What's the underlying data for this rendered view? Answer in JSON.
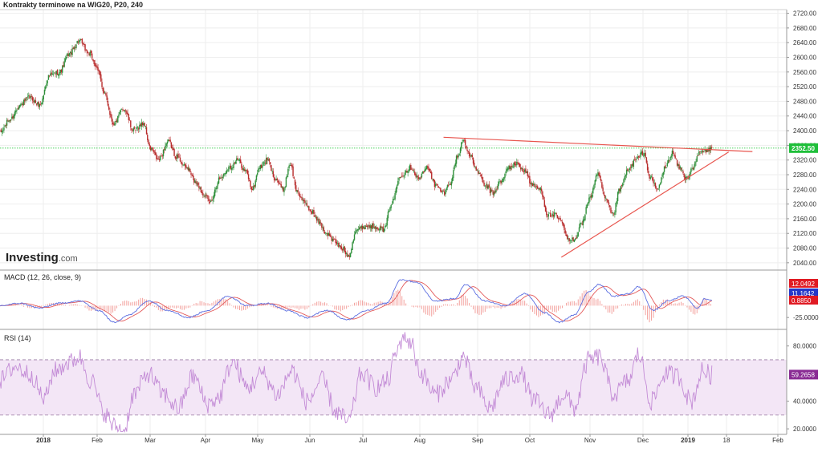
{
  "title": "Kontrakty terminowe na WIG20, P20, 240",
  "brand": {
    "name": "Investing",
    "suffix": ".com"
  },
  "colors": {
    "up": "#2f8f3a",
    "down": "#b82c2c",
    "grid": "#eeeeee",
    "border": "#c8c8c8",
    "text": "#333333",
    "price_line": "#27c93f",
    "trend": "#e8554e",
    "macd": "#5b6ee1",
    "signal": "#e35a5a",
    "hist_pos": "#f3a19d",
    "hist_neg": "#f3a19d",
    "rsi": "#c38bd6",
    "rsi_band": "#f3e6f6",
    "macd_tag": "#e01b24",
    "signal_tag": "#2438c9",
    "hist_tag": "#e01b24",
    "rsi_tag": "#8a2c94"
  },
  "x_axis": {
    "labels": [
      "2018",
      "Feb",
      "Mar",
      "Apr",
      "May",
      "Jun",
      "Jul",
      "Aug",
      "Sep",
      "Oct",
      "Nov",
      "Dec",
      "2019",
      "18",
      "Feb"
    ],
    "bold": [
      "2018",
      "2019"
    ]
  },
  "chart_data": [
    {
      "type": "candlestick",
      "name": "Kontrakty terminowe na WIG20, P20, 240",
      "y_ticks": [
        "2720.00",
        "2680.00",
        "2640.00",
        "2600.00",
        "2560.00",
        "2520.00",
        "2480.00",
        "2440.00",
        "2400.00",
        "2360.00",
        "2320.00",
        "2280.00",
        "2240.00",
        "2200.00",
        "2160.00",
        "2120.00",
        "2080.00",
        "2040.00"
      ],
      "ylim": [
        2020,
        2730
      ],
      "last_price": {
        "value": 2352.5,
        "label": "2352.50"
      },
      "anchors": [
        {
          "i": 0,
          "v": 2395
        },
        {
          "i": 10,
          "v": 2430
        },
        {
          "i": 20,
          "v": 2470
        },
        {
          "i": 30,
          "v": 2490
        },
        {
          "i": 40,
          "v": 2470
        },
        {
          "i": 50,
          "v": 2550
        },
        {
          "i": 60,
          "v": 2560
        },
        {
          "i": 70,
          "v": 2610
        },
        {
          "i": 80,
          "v": 2645
        },
        {
          "i": 90,
          "v": 2610
        },
        {
          "i": 100,
          "v": 2560
        },
        {
          "i": 105,
          "v": 2500
        },
        {
          "i": 115,
          "v": 2420
        },
        {
          "i": 125,
          "v": 2460
        },
        {
          "i": 135,
          "v": 2400
        },
        {
          "i": 145,
          "v": 2420
        },
        {
          "i": 152,
          "v": 2350
        },
        {
          "i": 160,
          "v": 2320
        },
        {
          "i": 170,
          "v": 2370
        },
        {
          "i": 178,
          "v": 2330
        },
        {
          "i": 188,
          "v": 2300
        },
        {
          "i": 198,
          "v": 2260
        },
        {
          "i": 205,
          "v": 2230
        },
        {
          "i": 212,
          "v": 2205
        },
        {
          "i": 222,
          "v": 2270
        },
        {
          "i": 232,
          "v": 2300
        },
        {
          "i": 240,
          "v": 2320
        },
        {
          "i": 248,
          "v": 2290
        },
        {
          "i": 255,
          "v": 2240
        },
        {
          "i": 262,
          "v": 2300
        },
        {
          "i": 270,
          "v": 2320
        },
        {
          "i": 278,
          "v": 2270
        },
        {
          "i": 286,
          "v": 2240
        },
        {
          "i": 293,
          "v": 2310
        },
        {
          "i": 300,
          "v": 2235
        },
        {
          "i": 308,
          "v": 2200
        },
        {
          "i": 315,
          "v": 2180
        },
        {
          "i": 322,
          "v": 2150
        },
        {
          "i": 330,
          "v": 2120
        },
        {
          "i": 337,
          "v": 2100
        },
        {
          "i": 345,
          "v": 2080
        },
        {
          "i": 352,
          "v": 2060
        },
        {
          "i": 360,
          "v": 2130
        },
        {
          "i": 370,
          "v": 2140
        },
        {
          "i": 378,
          "v": 2140
        },
        {
          "i": 388,
          "v": 2130
        },
        {
          "i": 395,
          "v": 2200
        },
        {
          "i": 405,
          "v": 2280
        },
        {
          "i": 415,
          "v": 2300
        },
        {
          "i": 423,
          "v": 2270
        },
        {
          "i": 432,
          "v": 2300
        },
        {
          "i": 440,
          "v": 2250
        },
        {
          "i": 448,
          "v": 2230
        },
        {
          "i": 455,
          "v": 2260
        },
        {
          "i": 462,
          "v": 2330
        },
        {
          "i": 468,
          "v": 2375
        },
        {
          "i": 475,
          "v": 2330
        },
        {
          "i": 482,
          "v": 2290
        },
        {
          "i": 490,
          "v": 2250
        },
        {
          "i": 498,
          "v": 2230
        },
        {
          "i": 506,
          "v": 2260
        },
        {
          "i": 514,
          "v": 2300
        },
        {
          "i": 522,
          "v": 2310
        },
        {
          "i": 530,
          "v": 2290
        },
        {
          "i": 538,
          "v": 2250
        },
        {
          "i": 546,
          "v": 2240
        },
        {
          "i": 553,
          "v": 2170
        },
        {
          "i": 560,
          "v": 2170
        },
        {
          "i": 567,
          "v": 2150
        },
        {
          "i": 574,
          "v": 2100
        },
        {
          "i": 580,
          "v": 2105
        },
        {
          "i": 588,
          "v": 2150
        },
        {
          "i": 596,
          "v": 2220
        },
        {
          "i": 604,
          "v": 2280
        },
        {
          "i": 612,
          "v": 2210
        },
        {
          "i": 619,
          "v": 2170
        },
        {
          "i": 626,
          "v": 2240
        },
        {
          "i": 634,
          "v": 2290
        },
        {
          "i": 642,
          "v": 2320
        },
        {
          "i": 650,
          "v": 2340
        },
        {
          "i": 657,
          "v": 2270
        },
        {
          "i": 664,
          "v": 2240
        },
        {
          "i": 672,
          "v": 2300
        },
        {
          "i": 679,
          "v": 2340
        },
        {
          "i": 686,
          "v": 2300
        },
        {
          "i": 693,
          "v": 2270
        },
        {
          "i": 700,
          "v": 2300
        },
        {
          "i": 707,
          "v": 2340
        },
        {
          "i": 714,
          "v": 2345
        },
        {
          "i": 719,
          "v": 2352
        }
      ],
      "trendlines": [
        {
          "name": "resistance",
          "from": {
            "i": 448,
            "v": 2382
          },
          "to": {
            "i": 760,
            "v": 2343
          }
        },
        {
          "name": "support",
          "from": {
            "i": 567,
            "v": 2055
          },
          "to": {
            "i": 736,
            "v": 2342
          }
        }
      ]
    },
    {
      "type": "line",
      "name": "MACD (12, 26, close, 9)",
      "y_ticks": [
        "-25.0000"
      ],
      "ylim": [
        -50,
        75
      ],
      "labels": {
        "macd": "12.0492",
        "signal": "11.1642",
        "histogram": "0.8850"
      },
      "anchors": [
        {
          "i": 0,
          "v": 0
        },
        {
          "i": 20,
          "v": 5
        },
        {
          "i": 40,
          "v": -5
        },
        {
          "i": 60,
          "v": 5
        },
        {
          "i": 80,
          "v": 10
        },
        {
          "i": 100,
          "v": -10
        },
        {
          "i": 115,
          "v": -35
        },
        {
          "i": 130,
          "v": -20
        },
        {
          "i": 150,
          "v": 10
        },
        {
          "i": 170,
          "v": -10
        },
        {
          "i": 190,
          "v": -25
        },
        {
          "i": 210,
          "v": -10
        },
        {
          "i": 230,
          "v": 20
        },
        {
          "i": 250,
          "v": 0
        },
        {
          "i": 270,
          "v": 5
        },
        {
          "i": 290,
          "v": -10
        },
        {
          "i": 310,
          "v": -25
        },
        {
          "i": 330,
          "v": -10
        },
        {
          "i": 350,
          "v": -30
        },
        {
          "i": 370,
          "v": -10
        },
        {
          "i": 390,
          "v": 5
        },
        {
          "i": 405,
          "v": 55
        },
        {
          "i": 420,
          "v": 50
        },
        {
          "i": 440,
          "v": 10
        },
        {
          "i": 460,
          "v": 15
        },
        {
          "i": 470,
          "v": 45
        },
        {
          "i": 490,
          "v": 10
        },
        {
          "i": 510,
          "v": 0
        },
        {
          "i": 530,
          "v": 25
        },
        {
          "i": 550,
          "v": -15
        },
        {
          "i": 565,
          "v": -35
        },
        {
          "i": 580,
          "v": -20
        },
        {
          "i": 595,
          "v": 30
        },
        {
          "i": 605,
          "v": 45
        },
        {
          "i": 620,
          "v": 20
        },
        {
          "i": 635,
          "v": 25
        },
        {
          "i": 645,
          "v": 40
        },
        {
          "i": 660,
          "v": -10
        },
        {
          "i": 675,
          "v": 10
        },
        {
          "i": 690,
          "v": 20
        },
        {
          "i": 705,
          "v": -5
        },
        {
          "i": 712,
          "v": 15
        },
        {
          "i": 719,
          "v": 12
        }
      ]
    },
    {
      "type": "line",
      "name": "RSI (14)",
      "y_ticks": [
        "80.0000",
        "40.0000",
        "20.0000"
      ],
      "ylim": [
        16,
        92
      ],
      "band": [
        30,
        70
      ],
      "last_value": {
        "value": 59.2658,
        "label": "59.2658"
      },
      "anchors": [
        {
          "i": 0,
          "v": 55
        },
        {
          "i": 15,
          "v": 65
        },
        {
          "i": 30,
          "v": 60
        },
        {
          "i": 45,
          "v": 42
        },
        {
          "i": 55,
          "v": 62
        },
        {
          "i": 70,
          "v": 68
        },
        {
          "i": 80,
          "v": 72
        },
        {
          "i": 92,
          "v": 55
        },
        {
          "i": 105,
          "v": 32
        },
        {
          "i": 115,
          "v": 22
        },
        {
          "i": 125,
          "v": 18
        },
        {
          "i": 135,
          "v": 45
        },
        {
          "i": 150,
          "v": 60
        },
        {
          "i": 165,
          "v": 45
        },
        {
          "i": 180,
          "v": 35
        },
        {
          "i": 195,
          "v": 58
        },
        {
          "i": 210,
          "v": 38
        },
        {
          "i": 220,
          "v": 42
        },
        {
          "i": 235,
          "v": 68
        },
        {
          "i": 250,
          "v": 50
        },
        {
          "i": 265,
          "v": 60
        },
        {
          "i": 280,
          "v": 45
        },
        {
          "i": 295,
          "v": 62
        },
        {
          "i": 310,
          "v": 40
        },
        {
          "i": 325,
          "v": 55
        },
        {
          "i": 340,
          "v": 32
        },
        {
          "i": 352,
          "v": 25
        },
        {
          "i": 365,
          "v": 60
        },
        {
          "i": 380,
          "v": 50
        },
        {
          "i": 392,
          "v": 55
        },
        {
          "i": 400,
          "v": 75
        },
        {
          "i": 408,
          "v": 88
        },
        {
          "i": 415,
          "v": 82
        },
        {
          "i": 425,
          "v": 60
        },
        {
          "i": 440,
          "v": 45
        },
        {
          "i": 455,
          "v": 55
        },
        {
          "i": 468,
          "v": 72
        },
        {
          "i": 480,
          "v": 50
        },
        {
          "i": 495,
          "v": 35
        },
        {
          "i": 510,
          "v": 55
        },
        {
          "i": 525,
          "v": 60
        },
        {
          "i": 540,
          "v": 40
        },
        {
          "i": 555,
          "v": 30
        },
        {
          "i": 570,
          "v": 45
        },
        {
          "i": 580,
          "v": 35
        },
        {
          "i": 595,
          "v": 70
        },
        {
          "i": 605,
          "v": 72
        },
        {
          "i": 620,
          "v": 45
        },
        {
          "i": 635,
          "v": 55
        },
        {
          "i": 645,
          "v": 74
        },
        {
          "i": 658,
          "v": 40
        },
        {
          "i": 672,
          "v": 60
        },
        {
          "i": 685,
          "v": 58
        },
        {
          "i": 698,
          "v": 40
        },
        {
          "i": 710,
          "v": 62
        },
        {
          "i": 719,
          "v": 59
        }
      ]
    }
  ]
}
